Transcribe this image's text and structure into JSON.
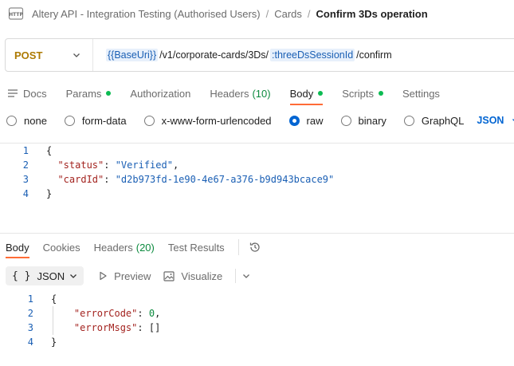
{
  "breadcrumb": {
    "items": [
      "Altery API - Integration Testing (Authorised Users)",
      "Cards"
    ],
    "separator": "/",
    "current": "Confirm 3Ds operation",
    "icon": "http-request-icon"
  },
  "request": {
    "method": "POST",
    "method_color": "#ad7a03",
    "url_parts": {
      "base_var": "{{BaseUri}}",
      "path1": "/v1/corporate-cards/3Ds/",
      "path_var": ":threeDsSessionId",
      "path2": "/confirm"
    }
  },
  "request_tabs": {
    "docs": "Docs",
    "params": "Params",
    "authorization": "Authorization",
    "headers": "Headers",
    "headers_count": "(10)",
    "body": "Body",
    "scripts": "Scripts",
    "settings": "Settings",
    "active": "Body"
  },
  "body_modes": {
    "options": [
      "none",
      "form-data",
      "x-www-form-urlencoded",
      "raw",
      "binary",
      "GraphQL"
    ],
    "selected": "raw",
    "language": "JSON"
  },
  "request_body": {
    "line_numbers": [
      "1",
      "2",
      "3",
      "4"
    ],
    "open_brace": "{",
    "close_brace": "}",
    "status_key": "\"status\"",
    "status_value": "\"Verified\"",
    "card_key": "\"cardId\"",
    "card_value": "\"d2b973fd-1e90-4e67-a376-b9d943bcace9\""
  },
  "response_tabs": {
    "body": "Body",
    "cookies": "Cookies",
    "headers": "Headers",
    "headers_count": "(20)",
    "test_results": "Test Results",
    "active": "Body"
  },
  "response_toolbar": {
    "format": "JSON",
    "braces": "{ }",
    "preview": "Preview",
    "visualize": "Visualize"
  },
  "response_body": {
    "line_numbers": [
      "1",
      "2",
      "3",
      "4"
    ],
    "open_brace": "{",
    "close_brace": "}",
    "error_code_key": "\"errorCode\"",
    "error_code_value": "0",
    "error_msgs_key": "\"errorMsgs\"",
    "error_msgs_value": "[]"
  },
  "colors": {
    "accent": "#ff6c37",
    "link_blue": "#0265d2",
    "success_dot": "#0cbb52"
  }
}
